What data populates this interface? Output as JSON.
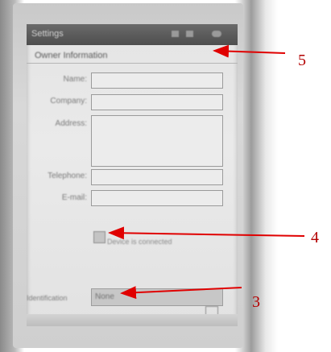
{
  "window": {
    "title": "Settings"
  },
  "section": {
    "title": "Owner Information"
  },
  "fields": [
    {
      "label": "Name:",
      "value": ""
    },
    {
      "label": "Company:",
      "value": ""
    },
    {
      "label": "Address:",
      "value": ""
    },
    {
      "label": "Telephone:",
      "value": ""
    },
    {
      "label": "E-mail:",
      "value": ""
    }
  ],
  "checkbox": {
    "label": "Device is connected",
    "checked": false
  },
  "identification": {
    "label": "Identification",
    "value": "None"
  },
  "annotations": [
    {
      "number": "5",
      "target": "title bar"
    },
    {
      "number": "4",
      "target": "checkbox"
    },
    {
      "number": "3",
      "target": "identification value"
    }
  ],
  "colors": {
    "annotation": "#cc0000",
    "titlebar": "#555555"
  }
}
